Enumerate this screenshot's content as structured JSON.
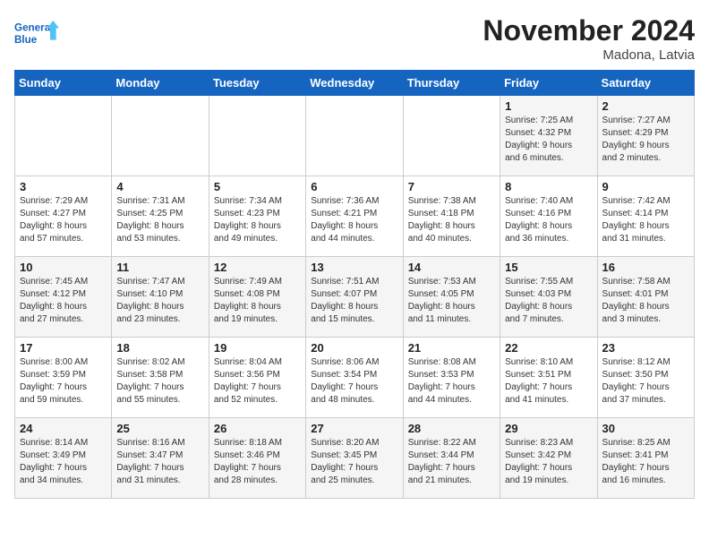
{
  "logo": {
    "line1": "General",
    "line2": "Blue"
  },
  "title": "November 2024",
  "subtitle": "Madona, Latvia",
  "days_of_week": [
    "Sunday",
    "Monday",
    "Tuesday",
    "Wednesday",
    "Thursday",
    "Friday",
    "Saturday"
  ],
  "weeks": [
    [
      {
        "day": "",
        "info": ""
      },
      {
        "day": "",
        "info": ""
      },
      {
        "day": "",
        "info": ""
      },
      {
        "day": "",
        "info": ""
      },
      {
        "day": "",
        "info": ""
      },
      {
        "day": "1",
        "info": "Sunrise: 7:25 AM\nSunset: 4:32 PM\nDaylight: 9 hours\nand 6 minutes."
      },
      {
        "day": "2",
        "info": "Sunrise: 7:27 AM\nSunset: 4:29 PM\nDaylight: 9 hours\nand 2 minutes."
      }
    ],
    [
      {
        "day": "3",
        "info": "Sunrise: 7:29 AM\nSunset: 4:27 PM\nDaylight: 8 hours\nand 57 minutes."
      },
      {
        "day": "4",
        "info": "Sunrise: 7:31 AM\nSunset: 4:25 PM\nDaylight: 8 hours\nand 53 minutes."
      },
      {
        "day": "5",
        "info": "Sunrise: 7:34 AM\nSunset: 4:23 PM\nDaylight: 8 hours\nand 49 minutes."
      },
      {
        "day": "6",
        "info": "Sunrise: 7:36 AM\nSunset: 4:21 PM\nDaylight: 8 hours\nand 44 minutes."
      },
      {
        "day": "7",
        "info": "Sunrise: 7:38 AM\nSunset: 4:18 PM\nDaylight: 8 hours\nand 40 minutes."
      },
      {
        "day": "8",
        "info": "Sunrise: 7:40 AM\nSunset: 4:16 PM\nDaylight: 8 hours\nand 36 minutes."
      },
      {
        "day": "9",
        "info": "Sunrise: 7:42 AM\nSunset: 4:14 PM\nDaylight: 8 hours\nand 31 minutes."
      }
    ],
    [
      {
        "day": "10",
        "info": "Sunrise: 7:45 AM\nSunset: 4:12 PM\nDaylight: 8 hours\nand 27 minutes."
      },
      {
        "day": "11",
        "info": "Sunrise: 7:47 AM\nSunset: 4:10 PM\nDaylight: 8 hours\nand 23 minutes."
      },
      {
        "day": "12",
        "info": "Sunrise: 7:49 AM\nSunset: 4:08 PM\nDaylight: 8 hours\nand 19 minutes."
      },
      {
        "day": "13",
        "info": "Sunrise: 7:51 AM\nSunset: 4:07 PM\nDaylight: 8 hours\nand 15 minutes."
      },
      {
        "day": "14",
        "info": "Sunrise: 7:53 AM\nSunset: 4:05 PM\nDaylight: 8 hours\nand 11 minutes."
      },
      {
        "day": "15",
        "info": "Sunrise: 7:55 AM\nSunset: 4:03 PM\nDaylight: 8 hours\nand 7 minutes."
      },
      {
        "day": "16",
        "info": "Sunrise: 7:58 AM\nSunset: 4:01 PM\nDaylight: 8 hours\nand 3 minutes."
      }
    ],
    [
      {
        "day": "17",
        "info": "Sunrise: 8:00 AM\nSunset: 3:59 PM\nDaylight: 7 hours\nand 59 minutes."
      },
      {
        "day": "18",
        "info": "Sunrise: 8:02 AM\nSunset: 3:58 PM\nDaylight: 7 hours\nand 55 minutes."
      },
      {
        "day": "19",
        "info": "Sunrise: 8:04 AM\nSunset: 3:56 PM\nDaylight: 7 hours\nand 52 minutes."
      },
      {
        "day": "20",
        "info": "Sunrise: 8:06 AM\nSunset: 3:54 PM\nDaylight: 7 hours\nand 48 minutes."
      },
      {
        "day": "21",
        "info": "Sunrise: 8:08 AM\nSunset: 3:53 PM\nDaylight: 7 hours\nand 44 minutes."
      },
      {
        "day": "22",
        "info": "Sunrise: 8:10 AM\nSunset: 3:51 PM\nDaylight: 7 hours\nand 41 minutes."
      },
      {
        "day": "23",
        "info": "Sunrise: 8:12 AM\nSunset: 3:50 PM\nDaylight: 7 hours\nand 37 minutes."
      }
    ],
    [
      {
        "day": "24",
        "info": "Sunrise: 8:14 AM\nSunset: 3:49 PM\nDaylight: 7 hours\nand 34 minutes."
      },
      {
        "day": "25",
        "info": "Sunrise: 8:16 AM\nSunset: 3:47 PM\nDaylight: 7 hours\nand 31 minutes."
      },
      {
        "day": "26",
        "info": "Sunrise: 8:18 AM\nSunset: 3:46 PM\nDaylight: 7 hours\nand 28 minutes."
      },
      {
        "day": "27",
        "info": "Sunrise: 8:20 AM\nSunset: 3:45 PM\nDaylight: 7 hours\nand 25 minutes."
      },
      {
        "day": "28",
        "info": "Sunrise: 8:22 AM\nSunset: 3:44 PM\nDaylight: 7 hours\nand 21 minutes."
      },
      {
        "day": "29",
        "info": "Sunrise: 8:23 AM\nSunset: 3:42 PM\nDaylight: 7 hours\nand 19 minutes."
      },
      {
        "day": "30",
        "info": "Sunrise: 8:25 AM\nSunset: 3:41 PM\nDaylight: 7 hours\nand 16 minutes."
      }
    ]
  ]
}
